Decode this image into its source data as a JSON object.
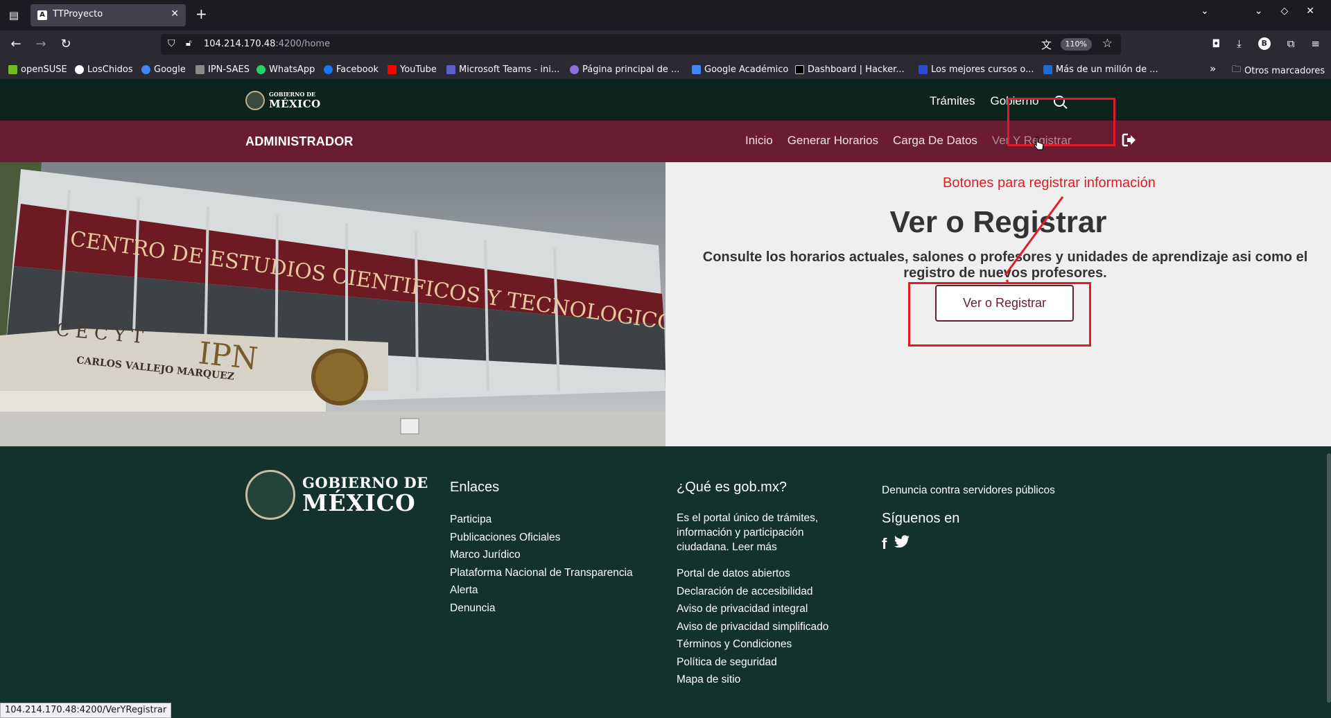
{
  "browser": {
    "tab_title": "TTProyecto",
    "url_host": "104.214.170.48",
    "url_rest": ":4200/home",
    "zoom": "110%",
    "bookmarks": [
      "openSUSE",
      "LosChidos",
      "Google",
      "IPN-SAES",
      "WhatsApp",
      "Facebook",
      "YouTube",
      "Microsoft Teams - ini...",
      "Página principal de ...",
      "Google Académico",
      "Dashboard | Hacker...",
      "Los mejores cursos o...",
      "Más de un millón de ..."
    ],
    "other_bookmarks": "Otros marcadores",
    "profile_initial": "B",
    "status_url": "104.214.170.48:4200/VerYRegistrar"
  },
  "gob_header": {
    "logo_small": "GOBIERNO DE",
    "logo_big": "MÉXICO",
    "nav": [
      "Trámites",
      "Gobierno"
    ]
  },
  "admin_bar": {
    "title": "ADMINISTRADOR",
    "nav": [
      "Inicio",
      "Generar Horarios",
      "Carga De Datos",
      "Ver Y Registrar"
    ]
  },
  "hero": {
    "heading": "Ver o Registrar",
    "description": "Consulte los horarios actuales, salones o profesores y unidades de aprendizaje asi como el registro de nuevos profesores.",
    "button": "Ver o Registrar",
    "annotation": "Botones para registrar información",
    "photo": {
      "sign_top": "CENTRO DE ESTUDIOS CIENTIFICOS Y TECNOLOGICOS",
      "sign_cecyt": "C E C Y T",
      "sign_ipn": "IPN",
      "sign_name": "CARLOS VALLEJO MARQUEZ"
    }
  },
  "footer": {
    "logo_line1": "GOBIERNO DE",
    "logo_line2": "MÉXICO",
    "enlaces_title": "Enlaces",
    "enlaces": [
      "Participa",
      "Publicaciones Oficiales",
      "Marco Jurídico",
      "Plataforma Nacional de Transparencia",
      "Alerta",
      "Denuncia"
    ],
    "que_es_title": "¿Qué es gob.mx?",
    "que_es_text": "Es el portal único de trámites, información y participación ciudadana. Leer más",
    "que_es_links": [
      "Portal de datos abiertos",
      "Declaración de accesibilidad",
      "Aviso de privacidad integral",
      "Aviso de privacidad simplificado",
      "Términos y Condiciones",
      "Política de seguridad",
      "Mapa de sitio"
    ],
    "denuncia": "Denuncia contra servidores públicos",
    "siguenos": "Síguenos en"
  },
  "colors": {
    "header_green": "#0c231e",
    "admin_maroon": "#691c32",
    "footer_green": "#12322b",
    "annotation_red": "#e01b24"
  }
}
